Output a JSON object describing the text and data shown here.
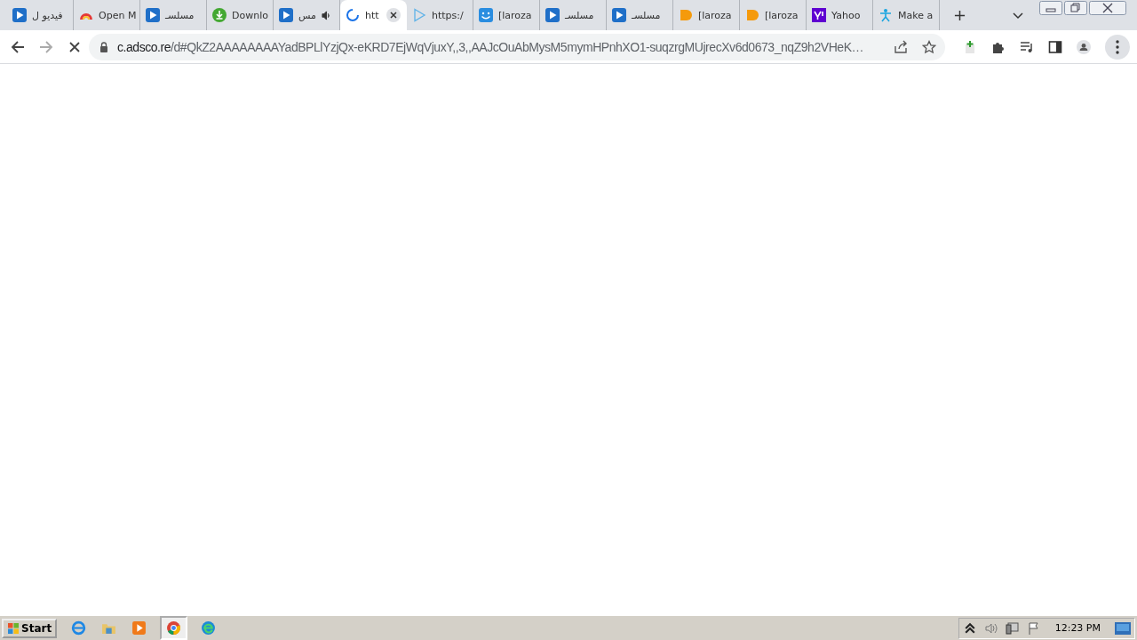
{
  "tabs": [
    {
      "kind": "play",
      "title": "فيديو ل",
      "selected": false,
      "audio": false
    },
    {
      "kind": "rainbow",
      "title": "Open M",
      "selected": false,
      "audio": false
    },
    {
      "kind": "play",
      "title": "مسلسـ",
      "selected": false,
      "audio": false
    },
    {
      "kind": "download",
      "title": "Downlo",
      "selected": false,
      "audio": false
    },
    {
      "kind": "play",
      "title": "مس",
      "selected": false,
      "audio": true
    },
    {
      "kind": "loading",
      "title": "htt",
      "selected": true,
      "audio": false
    },
    {
      "kind": "play-outline",
      "title": "https:/",
      "selected": false,
      "audio": false
    },
    {
      "kind": "smile",
      "title": "[laroza",
      "selected": false,
      "audio": false
    },
    {
      "kind": "play",
      "title": "مسلسـ",
      "selected": false,
      "audio": false
    },
    {
      "kind": "play",
      "title": "مسلسـ",
      "selected": false,
      "audio": false
    },
    {
      "kind": "blob",
      "title": "[laroza",
      "selected": false,
      "audio": false
    },
    {
      "kind": "blob",
      "title": "[laroza",
      "selected": false,
      "audio": false
    },
    {
      "kind": "yahoo",
      "title": "Yahoo",
      "selected": false,
      "audio": false
    },
    {
      "kind": "figure",
      "title": "Make a",
      "selected": false,
      "audio": false
    }
  ],
  "address": {
    "host": "c.adsco.re",
    "path": "/d#QkZ2AAAAAAAAYadBPLlYzjQx-eKRD7EjWqVjuxY,,3,,AAJcOuAbMysM5mymHPnhXO1-suqzrgMUjrecXv6d0673_nqZ9h2VHeK…"
  },
  "taskbar": {
    "start": "Start",
    "clock": "12:23 PM"
  }
}
